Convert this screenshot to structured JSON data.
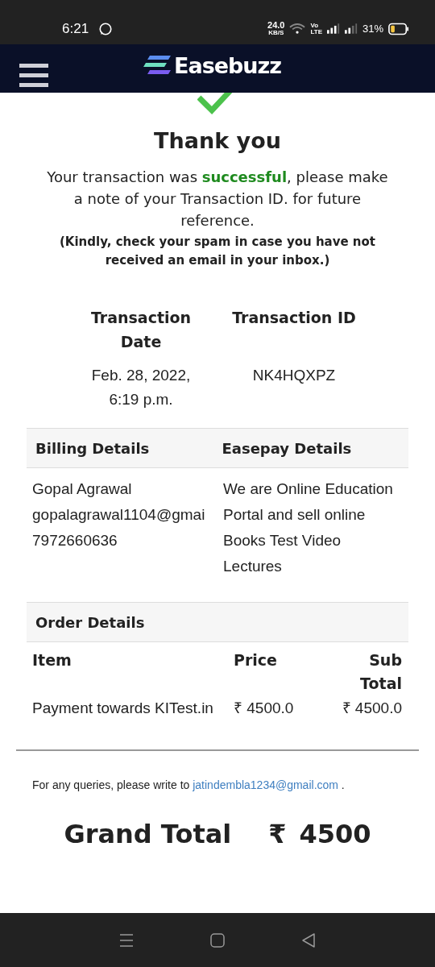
{
  "status_bar": {
    "time": "6:21",
    "speed_value": "24.0",
    "speed_unit": "KB/S",
    "network_top": "Vo",
    "network_bottom": "LTE",
    "battery": "31%"
  },
  "header": {
    "brand": "Easebuzz"
  },
  "title": "Thank you",
  "message": "Your transaction was **successful**, please make a note of your Transaction ID. for future reference.",
  "note": "(Kindly, check your spam in case you have not received an email in your inbox.)",
  "transaction": [
    {
      "label": "Transaction Date",
      "value": "Feb. 28, 2022, 6:19 p.m."
    },
    {
      "label": "Transaction ID",
      "value": "NK4HQXPZ"
    }
  ],
  "billing": {
    "columns": [
      "Billing Details",
      "Easepay Details"
    ],
    "lines": [
      "Gopal Agrawal",
      "gopalagrawal1104@gmai",
      "7972660636"
    ],
    "description": "We are Online Education Portal and sell online Books Test Video Lectures"
  },
  "order": {
    "title": "Order Details",
    "columns": [
      "Item",
      "Price",
      "Sub Total"
    ],
    "rows": [
      {
        "item": "Payment towards KITest.in",
        "price": "₹ 4500.0",
        "subtotal": "₹ 4500.0"
      }
    ]
  },
  "queries": {
    "text": "For any queries, please write to",
    "email": "jatindembla1234@gmail.com",
    "end": "."
  },
  "grand_total": {
    "label": "Grand Total",
    "currency": "₹",
    "amount": "4500"
  }
}
